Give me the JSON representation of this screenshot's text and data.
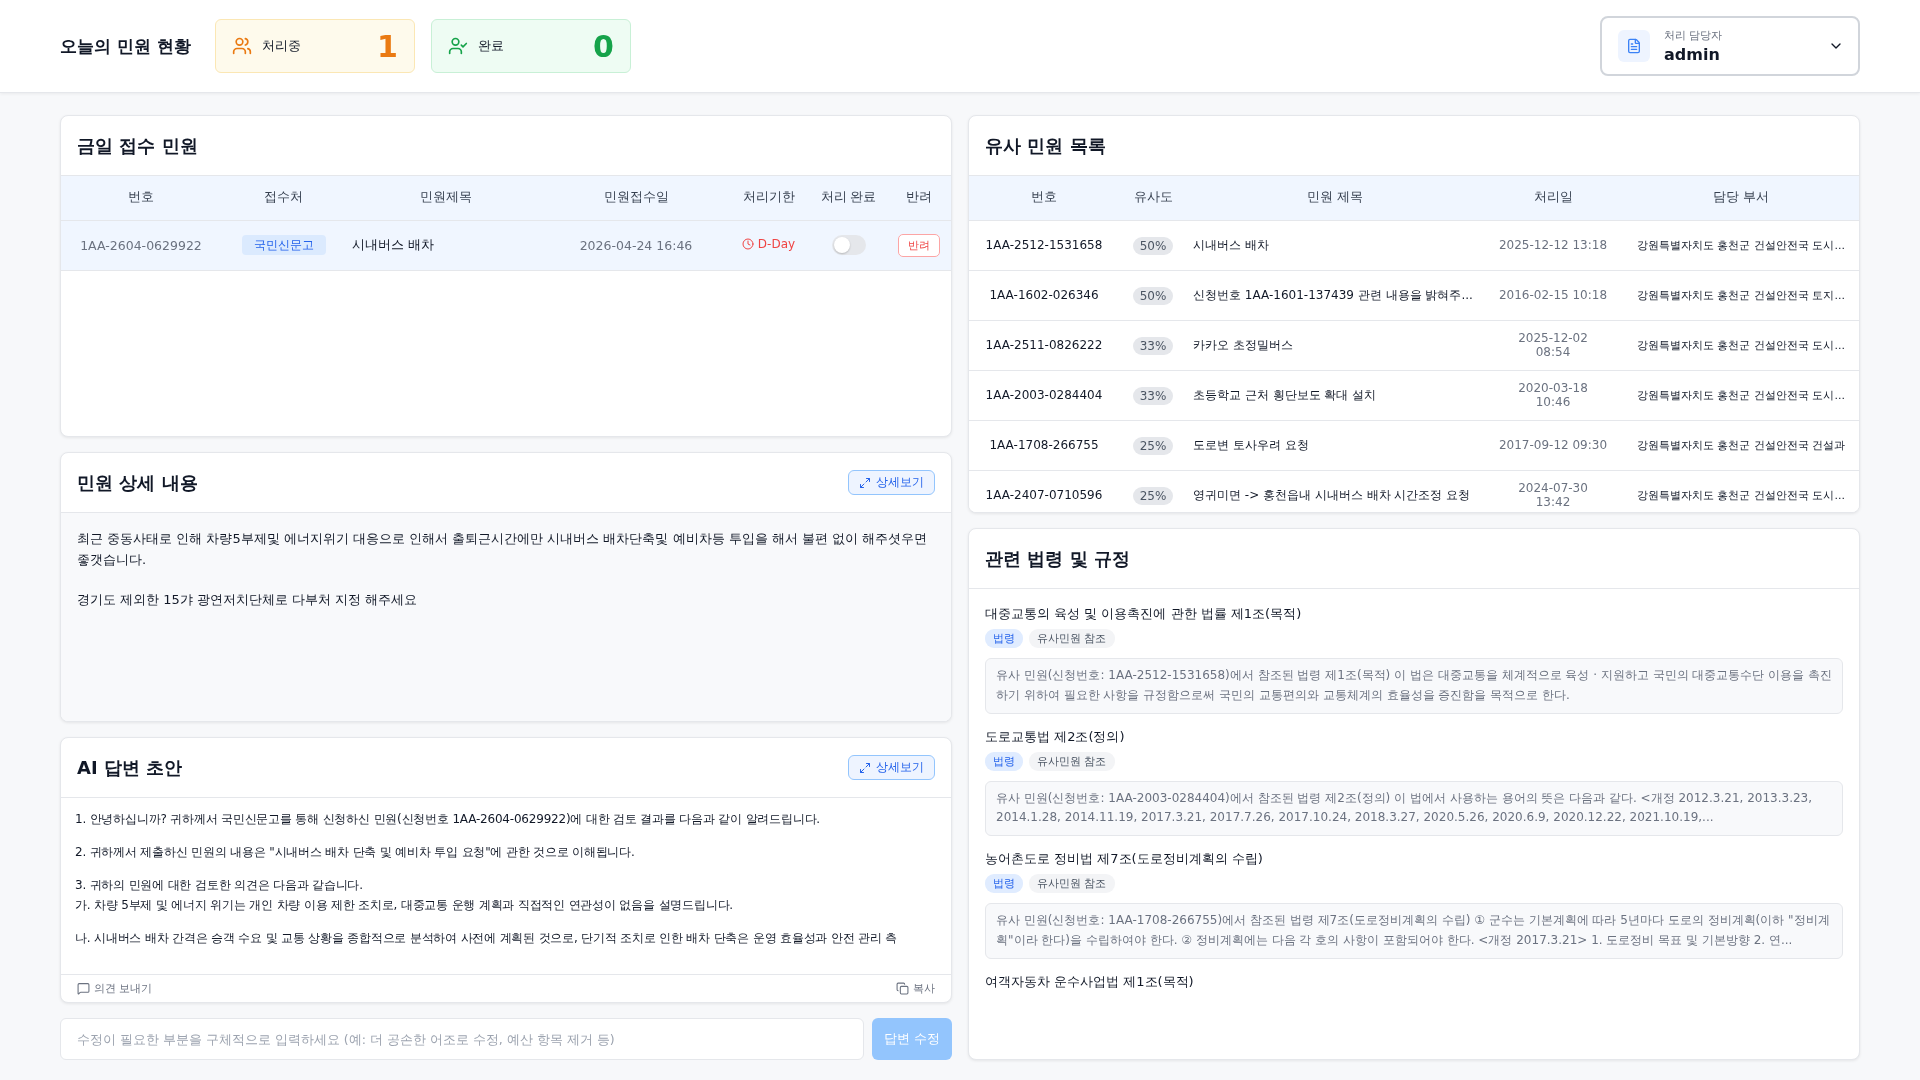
{
  "header": {
    "title": "오늘의 민원 현황",
    "stats": [
      {
        "kind": "processing",
        "label": "처리중",
        "count": "1"
      },
      {
        "kind": "done",
        "label": "완료",
        "count": "0"
      }
    ],
    "assignee": {
      "label": "처리 담당자",
      "value": "admin"
    }
  },
  "today": {
    "title": "금일 접수 민원",
    "columns": [
      "번호",
      "접수처",
      "민원제목",
      "민원접수일",
      "처리기한",
      "처리 완료",
      "반려"
    ],
    "rows": [
      {
        "number": "1AA-2604-0629922",
        "source": "국민신문고",
        "subject": "시내버스 배차",
        "received": "2026-04-24 16:46",
        "deadline": "D-Day",
        "done": false,
        "reject": "반려",
        "selected": true
      }
    ]
  },
  "detail": {
    "title": "민원 상세 내용",
    "expand": "상세보기",
    "paragraphs": [
      "최근 중동사태로 인해 차량5부제및 에너지위기 대응으로 인해서 출퇴근시간에만 시내버스 배차단축및 예비차등 투입을 해서 불편 없이 해주셧우면 좋갯습니다.",
      "경기도 제외한 15갸 광연저치단체로 다부처 지정 해주세요"
    ]
  },
  "draft": {
    "title": "AI 답변 초안",
    "expand": "상세보기",
    "paragraphs": [
      "1. 안녕하십니까? 귀하께서 국민신문고를 통해 신청하신 민원(신청번호 1AA-2604-0629922)에 대한 검토 결과를 다음과 같이 알려드립니다.",
      "2. 귀하께서 제출하신 민원의 내용은 \"시내버스 배차 단축 및 예비차 투입 요청\"에 관한 것으로 이해됩니다.",
      "3. 귀하의 민원에 대한 검토한 의견은 다음과 같습니다.\n가. 차량 5부제 및 에너지 위기는 개인 차량 이용 제한 조치로, 대중교통 운행 계획과 직접적인 연관성이 없음을 설명드립니다.",
      "나. 시내버스 배차 간격은 승객 수요 및 교통 상황을 종합적으로 분석하여 사전에 계획된 것으로, 단기적 조치로 인한 배차 단축은 운영 효율성과 안전 관리 측"
    ],
    "feedback": "의견 보내기",
    "copy": "복사"
  },
  "revise": {
    "placeholder": "수정이 필요한 부분을 구체적으로 입력하세요 (예: 더 공손한 어조로 수정, 예산 항목 제거 등)",
    "button": "답변 수정",
    "disabled": true
  },
  "similar": {
    "title": "유사 민원 목록",
    "columns": [
      "번호",
      "유사도",
      "민원 제목",
      "처리일",
      "담당 부서"
    ],
    "rows": [
      {
        "number": "1AA-2512-1531658",
        "similarity": "50%",
        "subject": "시내버스 배차",
        "date": "2025-12-12 13:18",
        "dept": "강원특별자치도 홍천군 건설안전국 도시..."
      },
      {
        "number": "1AA-1602-026346",
        "similarity": "50%",
        "subject": "신청번호 1AA-1601-137439 관련 내용을 밝혀주...",
        "date": "2016-02-15 10:18",
        "dept": "강원특별자치도 홍천군 건설안전국 토지..."
      },
      {
        "number": "1AA-2511-0826222",
        "similarity": "33%",
        "subject": "카카오 초정밀버스",
        "date": "2025-12-02\n08:54",
        "dept": "강원특별자치도 홍천군 건설안전국 도시..."
      },
      {
        "number": "1AA-2003-0284404",
        "similarity": "33%",
        "subject": "초등학교 근처 횡단보도 확대 설치",
        "date": "2020-03-18\n10:46",
        "dept": "강원특별자치도 홍천군 건설안전국 도시..."
      },
      {
        "number": "1AA-1708-266755",
        "similarity": "25%",
        "subject": "도로변 토사우려 요청",
        "date": "2017-09-12 09:30",
        "dept": "강원특별자치도 홍천군 건설안전국 건설과"
      },
      {
        "number": "1AA-2407-0710596",
        "similarity": "25%",
        "subject": "영귀미면 -> 홍천읍내 시내버스 배차 시간조정 요청",
        "date": "2024-07-30\n13:42",
        "dept": "강원특별자치도 홍천군 건설안전국 도시..."
      }
    ]
  },
  "laws": {
    "title": "관련 법령 및 규정",
    "items": [
      {
        "name": "대중교통의 육성 및 이용촉진에 관한 법률 제1조(목적)",
        "tags": [
          "법령",
          "유사민원 참조"
        ],
        "text": "유사 민원(신청번호: 1AA-2512-1531658)에서 참조된 법령 제1조(목적) 이 법은 대중교통을 체계적으로 육성 · 지원하고 국민의 대중교통수단 이용을 촉진하기 위하여 필요한 사항을 규정함으로써 국민의 교통편의와 교통체계의 효율성을 증진함을 목적으로 한다."
      },
      {
        "name": "도로교통법 제2조(정의)",
        "tags": [
          "법령",
          "유사민원 참조"
        ],
        "text": "유사 민원(신청번호: 1AA-2003-0284404)에서 참조된 법령 제2조(정의) 이 법에서 사용하는 용어의 뜻은 다음과 같다. <개정 2012.3.21, 2013.3.23, 2014.1.28, 2014.11.19, 2017.3.21, 2017.7.26, 2017.10.24, 2018.3.27, 2020.5.26, 2020.6.9, 2020.12.22, 2021.10.19,..."
      },
      {
        "name": "농어촌도로 정비법 제7조(도로정비계획의 수립)",
        "tags": [
          "법령",
          "유사민원 참조"
        ],
        "text": "유사 민원(신청번호: 1AA-1708-266755)에서 참조된 법령 제7조(도로정비계획의 수립) ① 군수는 기본계획에 따라 5년마다 도로의 정비계획(이하 \"정비계획\"이라 한다)을 수립하여야 한다. ② 정비계획에는 다음 각 호의 사항이 포함되어야 한다. <개정 2017.3.21> 1. 도로정비 목표 및 기본방향 2. 연..."
      },
      {
        "name": "여객자동차 운수사업법 제1조(목적)"
      }
    ]
  }
}
